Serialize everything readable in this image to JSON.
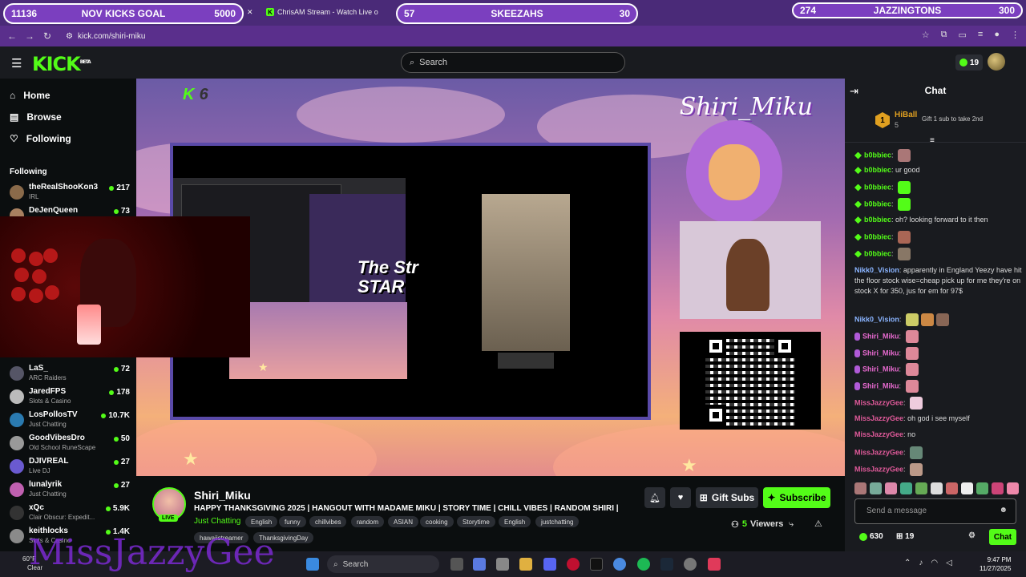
{
  "browser": {
    "goals": [
      {
        "left": "11136",
        "label": "NOV KICKS GOAL",
        "right": "5000"
      },
      {
        "left": "57",
        "label": "SKEEZAHS",
        "right": "30"
      },
      {
        "left": "274",
        "label": "JAZZINGTONS",
        "right": "300"
      }
    ],
    "tab_title": "ChrisAM Stream - Watch Live o",
    "url": "kick.com/shiri-miku"
  },
  "header": {
    "logo": "KICK",
    "logo_sup": "BETA",
    "search_placeholder": "Search",
    "points": "19"
  },
  "sidebar": {
    "nav": [
      {
        "label": "Home",
        "icon": "home-icon"
      },
      {
        "label": "Browse",
        "icon": "browse-icon"
      },
      {
        "label": "Following",
        "icon": "heart-icon"
      }
    ],
    "following_heading": "Following",
    "following": [
      {
        "name": "theRealShooKon3",
        "category": "IRL",
        "viewers": "217"
      },
      {
        "name": "DeJenQueen",
        "category": "",
        "viewers": "73"
      },
      {
        "name": "LaS_",
        "category": "ARC Raiders",
        "viewers": "72"
      },
      {
        "name": "JaredFPS",
        "category": "Slots & Casino",
        "viewers": "178"
      },
      {
        "name": "LosPollosTV",
        "category": "Just Chatting",
        "viewers": "10.7K"
      },
      {
        "name": "GoodVibesDro",
        "category": "Old School RuneScape",
        "viewers": "50"
      },
      {
        "name": "DJIVREAL",
        "category": "Live DJ",
        "viewers": "27"
      },
      {
        "name": "lunalyrik",
        "category": "Just Chatting",
        "viewers": "27"
      },
      {
        "name": "xQc",
        "category": "Clair Obscur: Expedit...",
        "viewers": "5.9K"
      },
      {
        "name": "keithlocks",
        "category": "Slots & Casino",
        "viewers": "1.4K"
      }
    ]
  },
  "video": {
    "overlay_name": "Shiri_Miku",
    "k_badge": "K",
    "k_num": "6",
    "screen_text": "The Str\nSTAR"
  },
  "stream": {
    "channel": "Shiri_Miku",
    "live": "LIVE",
    "title": "HAPPY THANKSGIVING 2025 | HANGOUT WITH MADAME MIKU | STORY TIME | CHILL VIBES | RANDOM SHIRI |",
    "category": "Just Chatting",
    "tags": [
      "English",
      "funny",
      "chillvibes",
      "random",
      "ASIAN",
      "cooking",
      "Storytime",
      "English",
      "justchatting"
    ],
    "tags2": [
      "hawaiistreamer",
      "ThanksgivingDay"
    ],
    "gift_label": "Gift Subs",
    "subscribe_label": "Subscribe",
    "viewers": "5",
    "viewers_label": "Viewers"
  },
  "chat": {
    "title": "Chat",
    "pinned": {
      "rank": "1",
      "user": "HiBall",
      "count": "5",
      "gift_text": "Gift 1 sub to take 2nd"
    },
    "messages": [
      {
        "user": "b0bbiec",
        "text": "",
        "color": "#53fc18"
      },
      {
        "user": "b0bbiec",
        "text": "ur good",
        "color": "#53fc18"
      },
      {
        "user": "b0bbiec",
        "text": "",
        "color": "#53fc18"
      },
      {
        "user": "b0bbiec",
        "text": "",
        "color": "#53fc18"
      },
      {
        "user": "b0bbiec",
        "text": "oh? looking forward to it then",
        "color": "#53fc18"
      },
      {
        "user": "b0bbiec",
        "text": "",
        "color": "#53fc18"
      },
      {
        "user": "b0bbiec",
        "text": "",
        "color": "#53fc18"
      },
      {
        "user": "Nikk0_Vision",
        "text": "apparently in England Yeezy have hit the floor stock wise=cheap pick up for me they're on stock X for 350, jus for em for 97$",
        "color": "#8ab4ff"
      },
      {
        "user": "Nikk0_Vision",
        "text": "",
        "color": "#8ab4ff"
      },
      {
        "user": "Shiri_Miku",
        "text": "",
        "color": "#e86ad0"
      },
      {
        "user": "Shiri_Miku",
        "text": "",
        "color": "#e86ad0"
      },
      {
        "user": "Shiri_Miku",
        "text": "",
        "color": "#e86ad0"
      },
      {
        "user": "Shiri_Miku",
        "text": "",
        "color": "#e86ad0"
      },
      {
        "user": "MissJazzyGee",
        "text": "",
        "color": "#e05a9a"
      },
      {
        "user": "MissJazzyGee",
        "text": "oh god i see myself",
        "color": "#e05a9a"
      },
      {
        "user": "MissJazzyGee",
        "text": "no",
        "color": "#e05a9a"
      },
      {
        "user": "MissJazzyGee",
        "text": "",
        "color": "#e05a9a"
      },
      {
        "user": "MissJazzyGee",
        "text": "",
        "color": "#e05a9a"
      }
    ],
    "input_placeholder": "Send a message",
    "points": "630",
    "gifts": "19",
    "send_label": "Chat"
  },
  "taskbar": {
    "weather_temp": "60°F",
    "weather_desc": "Clear",
    "search": "Search",
    "time": "9:47 PM",
    "date": "11/27/2025"
  },
  "watermark": "MissJazzyGee",
  "colors": {
    "accent": "#53fc18",
    "browser": "#5a2f8c",
    "panel": "#191b1f"
  }
}
